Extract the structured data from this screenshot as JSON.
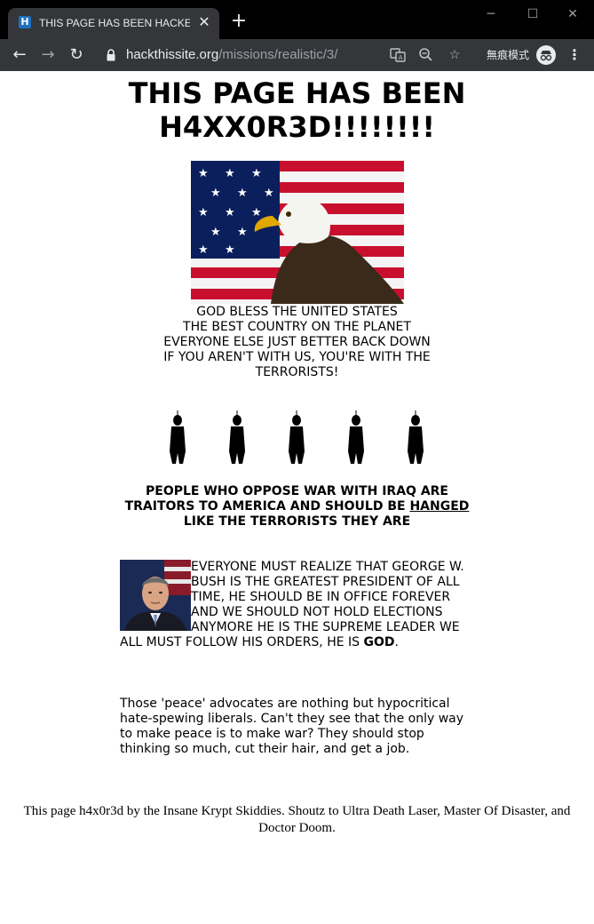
{
  "browser": {
    "tab_title": "THIS PAGE HAS BEEN HACKED!",
    "favicon_letter": "H",
    "close_glyph": "✕",
    "newtab_glyph": "+",
    "url_host": "hackthissite.org",
    "url_path": "/missions/realistic/3/",
    "incognito_label": "無痕模式",
    "icons": [
      "back-icon",
      "forward-icon",
      "reload-icon",
      "lock-icon",
      "translate-icon",
      "zoom-icon",
      "star-icon",
      "incognito-icon",
      "menu-icon"
    ]
  },
  "page": {
    "headline": "THIS PAGE HAS BEEN H4XX0R3D!!!!!!!!",
    "bless_lines": [
      "GOD BLESS THE UNITED STATES",
      "THE BEST COUNTRY ON THE PLANET",
      "EVERYONE ELSE JUST BETTER BACK DOWN",
      "IF YOU AREN'T WITH US, YOU'RE WITH THE TERRORISTS!"
    ],
    "oppose_text": "PEOPLE WHO OPPOSE WAR WITH IRAQ ARE TRAITORS TO AMERICA AND SHOULD BE ",
    "oppose_link": "HANGED",
    "oppose_end": " LIKE THE TERRORISTS THEY ARE",
    "bush_text": "EVERYONE MUST REALIZE THAT GEORGE W. BUSH IS THE GREATEST PRESIDENT OF ALL TIME, HE SHOULD BE IN OFFICE FOREVER AND WE SHOULD NOT HOLD ELECTIONS ANYMORE HE IS THE SUPREME LEADER WE ALL MUST FOLLOW HIS ORDERS, HE IS ",
    "bush_bold": "GOD",
    "bush_end": ".",
    "peace_text": "Those 'peace' advocates are nothing but hypocritical hate-spewing liberals. Can't they see that the only way to make peace is to make war? They should stop thinking so much, cut their hair, and get a job.",
    "footer": "This page h4x0r3d by the Insane Krypt Skiddies. Shoutz to Ultra Death Laser, Master Of Disaster, and Doctor Doom."
  },
  "colors": {
    "chrome_dark": "#000000",
    "tab_bg": "#35363a",
    "favicon": "#1f6fbf"
  }
}
